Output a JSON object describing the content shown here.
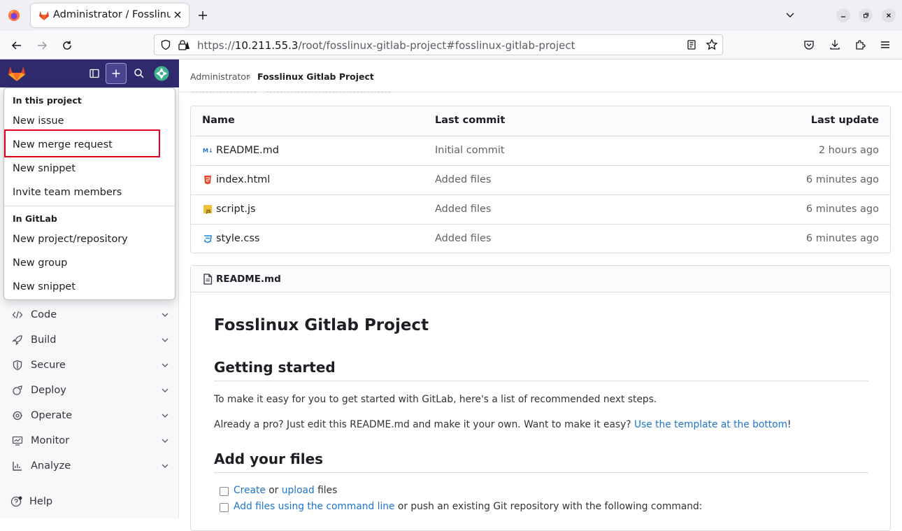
{
  "browser": {
    "tab_title": "Administrator / Fosslinux",
    "url_prefix": "https://",
    "url_host": "10.211.55.3",
    "url_path": "/root/fosslinux-gitlab-project#fosslinux-gitlab-project"
  },
  "breadcrumb": {
    "parent": "Administrator",
    "separator": "›",
    "current": "Fosslinux Gitlab Project"
  },
  "dropdown": {
    "section1_title": "In this project",
    "section1_items": [
      "New issue",
      "New merge request",
      "New snippet",
      "Invite team members"
    ],
    "section2_title": "In GitLab",
    "section2_items": [
      "New project/repository",
      "New group",
      "New snippet"
    ]
  },
  "sidebar": {
    "items": [
      {
        "label": "Code",
        "icon": "code-icon"
      },
      {
        "label": "Build",
        "icon": "rocket-icon"
      },
      {
        "label": "Secure",
        "icon": "shield-icon"
      },
      {
        "label": "Deploy",
        "icon": "deploy-icon"
      },
      {
        "label": "Operate",
        "icon": "operate-icon"
      },
      {
        "label": "Monitor",
        "icon": "monitor-icon"
      },
      {
        "label": "Analyze",
        "icon": "chart-icon"
      }
    ],
    "help": "Help"
  },
  "file_table": {
    "headers": {
      "name": "Name",
      "commit": "Last commit",
      "update": "Last update"
    },
    "rows": [
      {
        "name": "README.md",
        "commit": "Initial commit",
        "update": "2 hours ago",
        "icon": "markdown-icon"
      },
      {
        "name": "index.html",
        "commit": "Added files",
        "update": "6 minutes ago",
        "icon": "html-icon"
      },
      {
        "name": "script.js",
        "commit": "Added files",
        "update": "6 minutes ago",
        "icon": "js-icon"
      },
      {
        "name": "style.css",
        "commit": "Added files",
        "update": "6 minutes ago",
        "icon": "css-icon"
      }
    ]
  },
  "readme": {
    "file_label": "README.md",
    "title": "Fosslinux Gitlab Project",
    "getting_started": "Getting started",
    "intro": "To make it easy for you to get started with GitLab, here's a list of recommended next steps.",
    "pro_text": "Already a pro? Just edit this README.md and make it your own. Want to make it easy? ",
    "pro_link": "Use the template at the bottom",
    "pro_end": "!",
    "add_files": "Add your files",
    "check1_link1": "Create",
    "check1_or": " or ",
    "check1_link2": "upload",
    "check1_end": " files",
    "check2_link": "Add files using the command line",
    "check2_end": " or push an existing Git repository with the following command:"
  },
  "colors": {
    "gitlab_header": "#2f2a6b",
    "highlight_box": "#e2001a",
    "link": "#1f75cb"
  }
}
